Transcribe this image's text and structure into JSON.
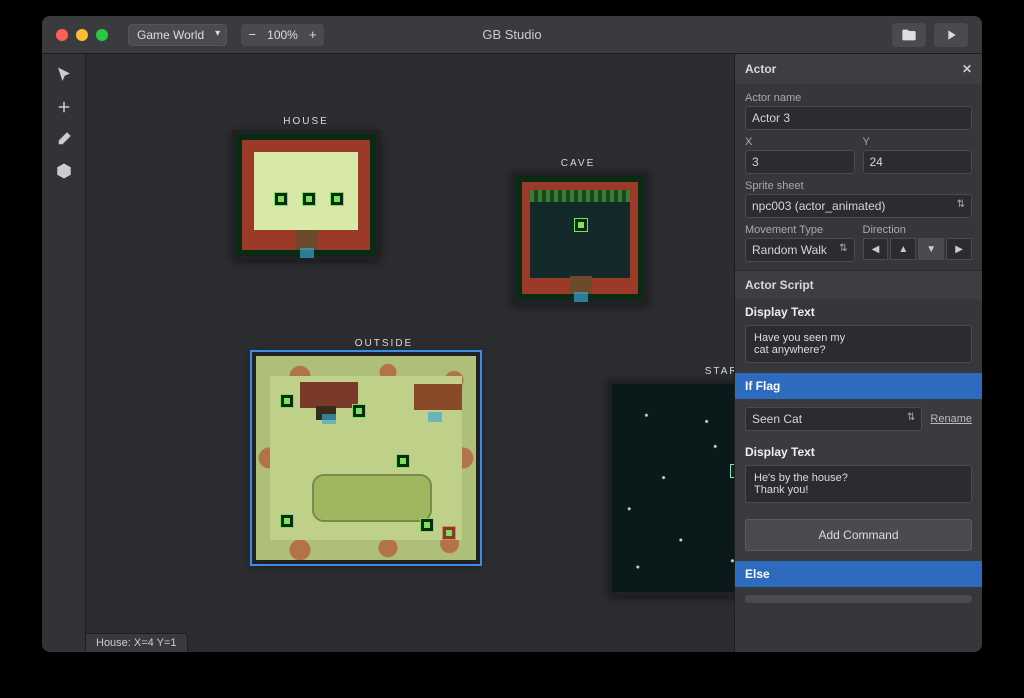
{
  "app": {
    "title": "GB Studio"
  },
  "titlebar": {
    "dropdown": "Game World",
    "zoom": "100%"
  },
  "canvas": {
    "scenes": {
      "house": "HOUSE",
      "cave": "CAVE",
      "outside": "OUTSIDE",
      "stars": "STARS"
    },
    "status": "House: X=4 Y=1"
  },
  "sidebar": {
    "panel_title": "Actor",
    "actor_name_label": "Actor name",
    "actor_name": "Actor 3",
    "x_label": "X",
    "x_value": "3",
    "y_label": "Y",
    "y_value": "24",
    "sprite_label": "Sprite sheet",
    "sprite_value": "npc003 (actor_animated)",
    "movement_label": "Movement Type",
    "movement_value": "Random Walk",
    "direction_label": "Direction",
    "script_header": "Actor Script",
    "ev1_header": "Display Text",
    "ev1_text": "Have you seen my\ncat anywhere?",
    "if_header": "If Flag",
    "flag_value": "Seen Cat",
    "rename": "Rename",
    "ev2_header": "Display Text",
    "ev2_text": "He's by the house?\nThank you!",
    "add_command": "Add Command",
    "else_header": "Else"
  }
}
